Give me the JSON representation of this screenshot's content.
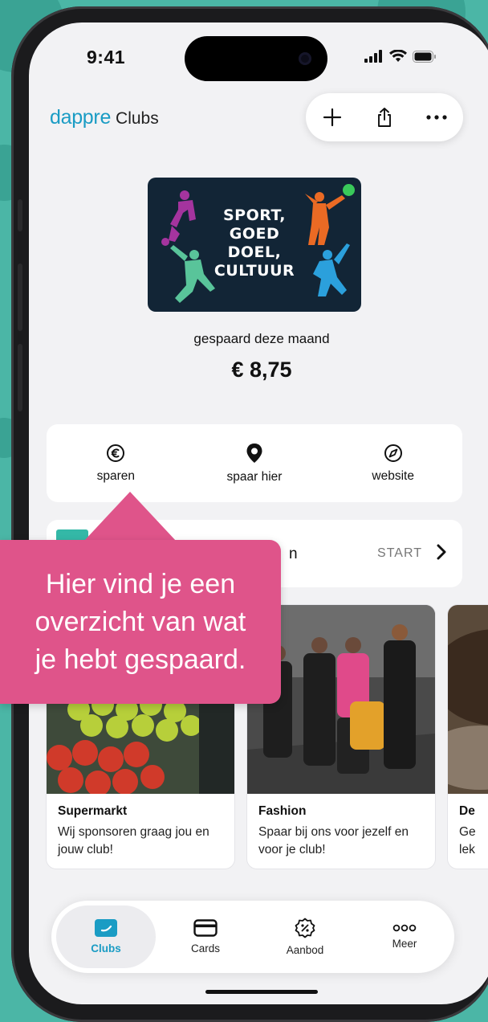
{
  "status_bar": {
    "time": "9:41"
  },
  "header": {
    "brand_logo": "dappre",
    "brand_sub": "Clubs",
    "actions": [
      "plus-icon",
      "share-icon",
      "more-icon"
    ]
  },
  "club": {
    "card_text_line1": "SPORT,",
    "card_text_line2": "GOED DOEL,",
    "card_text_line3": "CULTUUR",
    "status_color": "#39c95a",
    "savings_label": "gespaard deze maand",
    "savings_amount": "€ 8,75"
  },
  "quick_actions": [
    {
      "label": "sparen",
      "icon": "euro-icon"
    },
    {
      "label": "spaar hier",
      "icon": "location-pin-icon"
    },
    {
      "label": "website",
      "icon": "compass-icon"
    }
  ],
  "start_row": {
    "partial_text": "n",
    "action_label": "START",
    "icon": "chevron-right-icon"
  },
  "offers": [
    {
      "title": "Supermarkt",
      "description": "Wij sponsoren graag jou en jouw club!"
    },
    {
      "title": "Fashion",
      "description": "Spaar bij ons voor jezelf en voor je club!"
    },
    {
      "title": "De",
      "description": "Ge lek"
    }
  ],
  "tabbar": [
    {
      "label": "Clubs",
      "icon": "clubs-icon",
      "active": true
    },
    {
      "label": "Cards",
      "icon": "card-icon",
      "active": false
    },
    {
      "label": "Aanbod",
      "icon": "discount-badge-icon",
      "active": false
    },
    {
      "label": "Meer",
      "icon": "more-dots-icon",
      "active": false
    }
  ],
  "tooltip": {
    "line1": "Hier vind je een",
    "line2": "overzicht van wat",
    "line3": "je hebt gespaard."
  },
  "colors": {
    "accent": "#1a9cc4",
    "tooltip": "#df548a",
    "background": "#4bb6a6"
  }
}
